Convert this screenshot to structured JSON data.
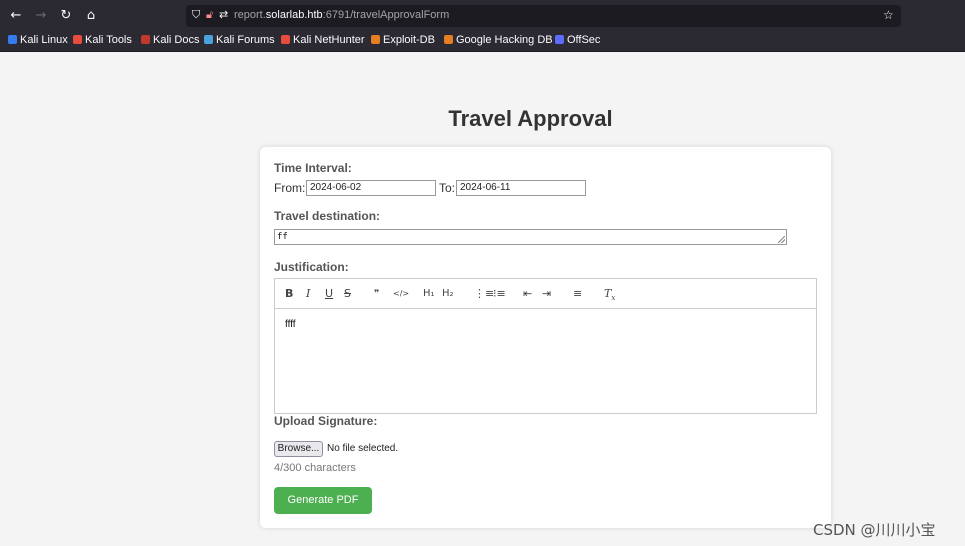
{
  "browser": {
    "url_prefix": "report.",
    "url_domain": "solarlab.htb",
    "url_rest": ":6791/travelApprovalForm",
    "bookmarks": [
      {
        "label": "Kali Linux",
        "color": "#367bf0"
      },
      {
        "label": "Kali Tools",
        "color": "#e74c3c"
      },
      {
        "label": "Kali Docs",
        "color": "#c0392b"
      },
      {
        "label": "Kali Forums",
        "color": "#4aa3df"
      },
      {
        "label": "Kali NetHunter",
        "color": "#e74c3c"
      },
      {
        "label": "Exploit-DB",
        "color": "#e67e22"
      },
      {
        "label": "Google Hacking DB",
        "color": "#e67e22"
      },
      {
        "label": "OffSec",
        "color": "#5b6cff"
      }
    ]
  },
  "page": {
    "title": "Travel Approval"
  },
  "form": {
    "time_interval_label": "Time Interval:",
    "from_label": "From:",
    "from_value": "2024-06-02",
    "to_label": "To:",
    "to_value": "2024-06-11",
    "destination_label": "Travel destination:",
    "destination_value": "ff",
    "justification_label": "Justification:",
    "justification_text": "ffff",
    "toolbar": [
      "B",
      "I",
      "U",
      "S",
      "99",
      "</>",
      "H1",
      "H2",
      "ol",
      "ul",
      "outdent",
      "indent",
      "align",
      "Tx"
    ],
    "upload_label": "Upload Signature:",
    "browse_label": "Browse...",
    "no_file_text": "No file selected.",
    "char_counter": "4/300 characters",
    "generate_label": "Generate PDF",
    "generate_color": "#4caf50"
  },
  "watermark": "CSDN @川川小宝"
}
